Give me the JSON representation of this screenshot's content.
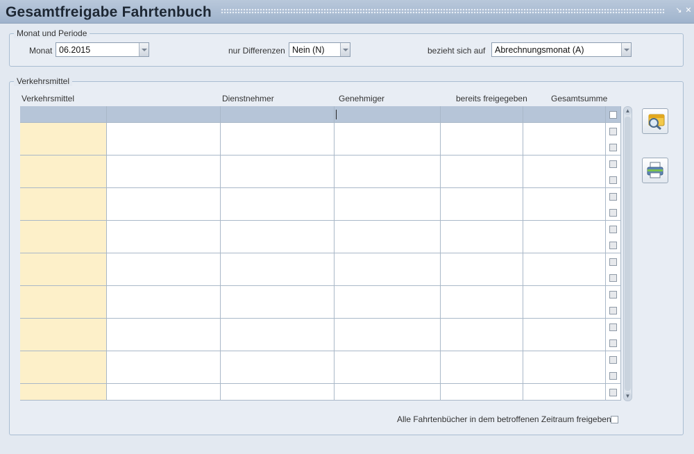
{
  "window": {
    "title": "Gesamtfreigabe Fahrtenbuch"
  },
  "period_panel": {
    "legend": "Monat und Periode",
    "monat_label": "Monat",
    "monat_value": "06.2015",
    "differenzen_label": "nur Differenzen",
    "differenzen_value": "Nein (N)",
    "bezieht_label": "bezieht sich auf",
    "bezieht_value": "Abrechnungsmonat (A)"
  },
  "vehicle_panel": {
    "legend": "Verkehrsmittel",
    "columns": [
      "Verkehrsmittel",
      "Dienstnehmer",
      "Genehmiger",
      "bereits freigegeben",
      "Gesamtsumme"
    ],
    "empty_rows": 17,
    "release_all_label": "Alle Fahrtenbücher in dem betroffenen Zeitraum freigeben"
  },
  "icons": {
    "search": "search-icon",
    "print": "printer-icon",
    "minimize": "minimize-icon",
    "close": "close-icon"
  },
  "colors": {
    "titlebar": "#a9bbd2",
    "highlight_column": "#fdf0c9",
    "header_row": "#b6c5d8"
  }
}
